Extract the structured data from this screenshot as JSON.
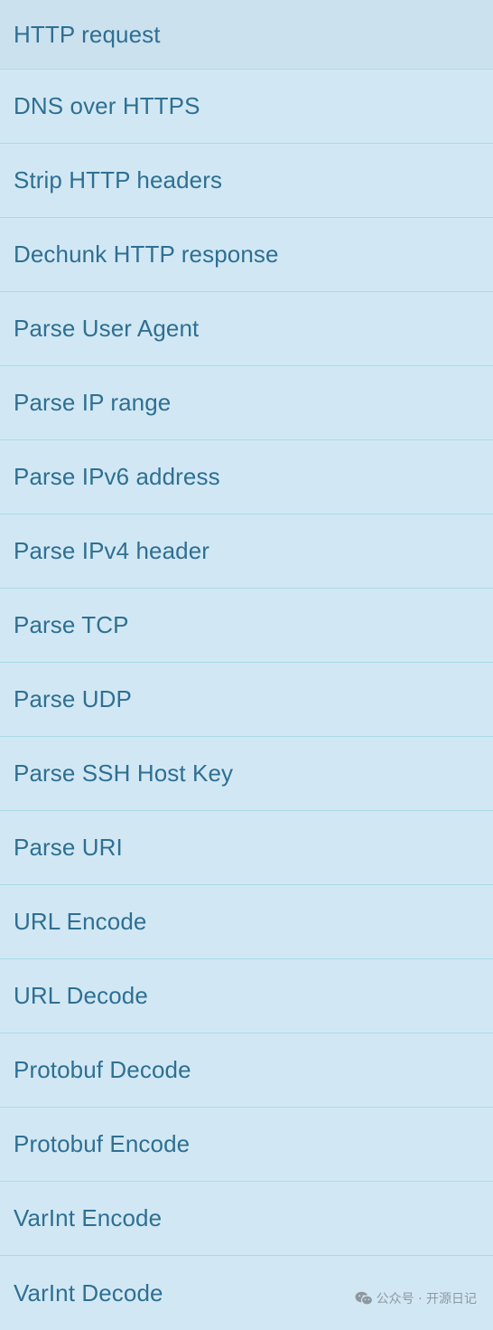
{
  "operations": [
    {
      "label": "HTTP request"
    },
    {
      "label": "DNS over HTTPS"
    },
    {
      "label": "Strip HTTP headers"
    },
    {
      "label": "Dechunk HTTP response"
    },
    {
      "label": "Parse User Agent"
    },
    {
      "label": "Parse IP range"
    },
    {
      "label": "Parse IPv6 address"
    },
    {
      "label": "Parse IPv4 header"
    },
    {
      "label": "Parse TCP"
    },
    {
      "label": "Parse UDP"
    },
    {
      "label": "Parse SSH Host Key"
    },
    {
      "label": "Parse URI"
    },
    {
      "label": "URL Encode"
    },
    {
      "label": "URL Decode"
    },
    {
      "label": "Protobuf Decode"
    },
    {
      "label": "Protobuf Encode"
    },
    {
      "label": "VarInt Encode"
    },
    {
      "label": "VarInt Decode"
    }
  ],
  "watermark": {
    "text": "公众号 · 开源日记",
    "icon": "wechat-icon"
  },
  "colors": {
    "row_background": "#d1e8f4",
    "row_divider": "#a9dbe8",
    "label_text": "#2f6f92"
  }
}
